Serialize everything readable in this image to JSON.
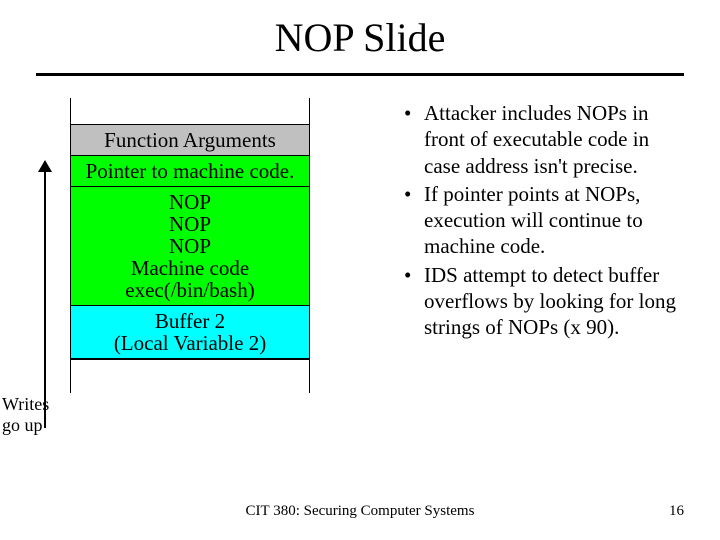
{
  "title": "NOP Slide",
  "stack": {
    "func_args": "Function Arguments",
    "pointer": "Pointer to machine code.",
    "shellcode": [
      "NOP",
      "NOP",
      "NOP",
      "Machine code",
      "exec(/bin/bash)"
    ],
    "buffer2": [
      "Buffer 2",
      "(Local Variable 2)"
    ]
  },
  "arrow_label": [
    "Writes",
    "go up"
  ],
  "bullets": [
    "Attacker includes NOPs in front of executable code in case address isn't precise.",
    "If pointer points at NOPs, execution will continue to machine code.",
    "IDS attempt to detect buffer overflows by looking for long strings of NOPs (x 90)."
  ],
  "footer": "CIT 380: Securing Computer Systems",
  "page": "16"
}
